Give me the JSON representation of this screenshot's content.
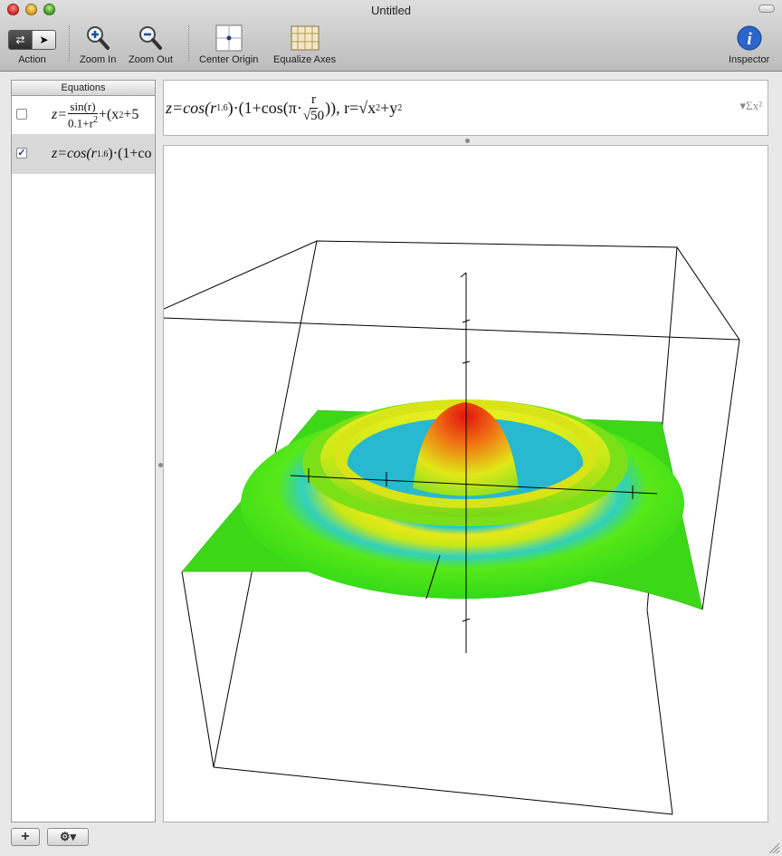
{
  "window": {
    "title": "Untitled"
  },
  "toolbar": {
    "action_label": "Action",
    "zoom_in_label": "Zoom In",
    "zoom_out_label": "Zoom Out",
    "center_origin_label": "Center Origin",
    "equalize_axes_label": "Equalize Axes",
    "inspector_label": "Inspector"
  },
  "sidebar": {
    "header": "Equations",
    "equations": [
      {
        "checked": false,
        "lhs": "z=",
        "num": "sin(r)",
        "den": "0.1+r",
        "den_sup": "2",
        "tail": "+(x",
        "tail_sup": "2",
        "tail2": "+5"
      },
      {
        "checked": true,
        "lhs": "z=cos(r",
        "lhs_sup": "1.6",
        "tail": ")·(1+co"
      }
    ]
  },
  "formula": {
    "p1": "z=cos(r",
    "p1_sup": "1.6",
    "p2": ")·(1+cos(π·",
    "frac_num": "r",
    "frac_den": "√50",
    "p3": ")), r=√x",
    "p3_sup": "2",
    "p4": "+y",
    "p4_sup": "2",
    "sigma": "▾Σx²"
  },
  "plot": {
    "equation": "z = cos(r^1.6)·(1+cos(π·r/√50)), r = √(x²+y²)",
    "surface_colors": {
      "peak": "#e02010",
      "high": "#f0e010",
      "mid": "#40e010",
      "low": "#10c0e0"
    }
  },
  "bottom": {
    "add_label": "+",
    "gear_label": "⚙▾"
  }
}
